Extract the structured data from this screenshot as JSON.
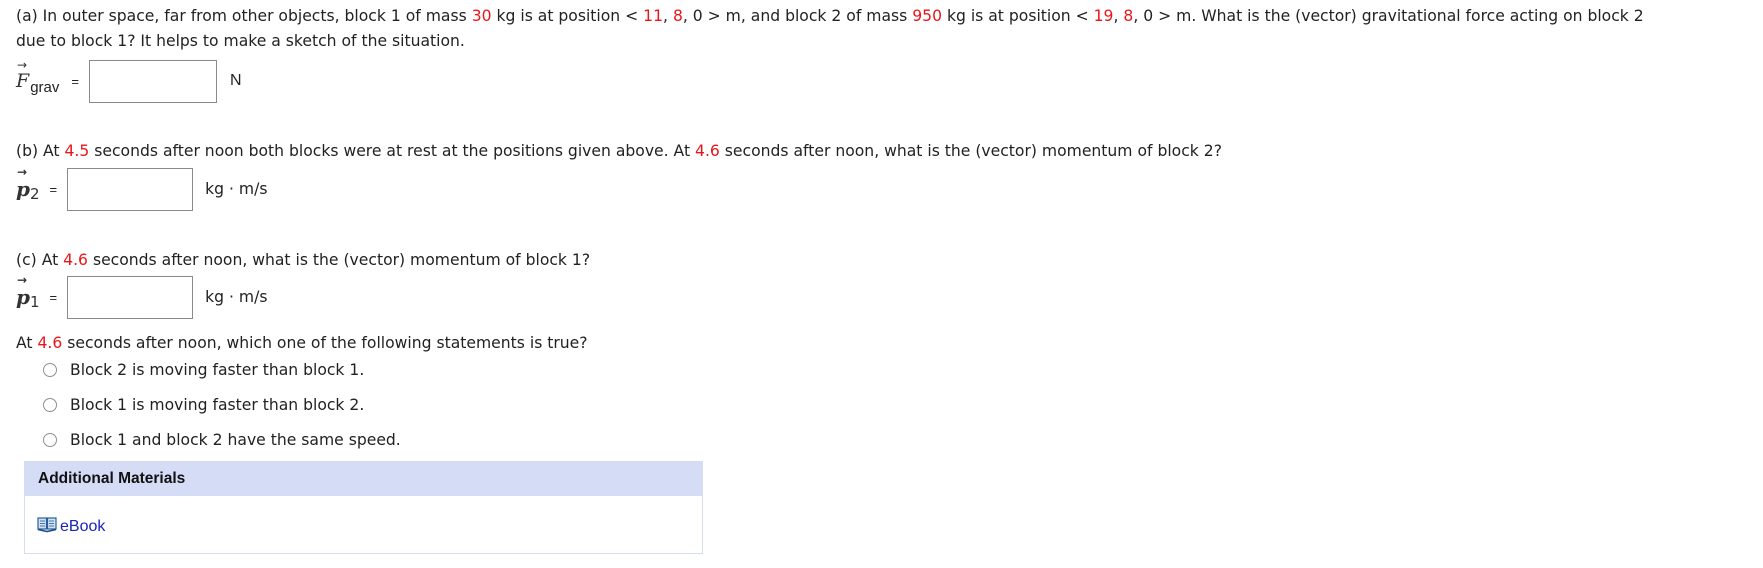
{
  "part_a": {
    "text": [
      {
        "t": "(a) In outer space, far from other objects, block 1 of mass "
      },
      {
        "t": "30",
        "red": true
      },
      {
        "t": " kg is at position < "
      },
      {
        "t": "11",
        "red": true
      },
      {
        "t": ", "
      },
      {
        "t": "8",
        "red": true
      },
      {
        "t": ", 0 > m, and block 2 of mass "
      },
      {
        "t": "950",
        "red": true
      },
      {
        "t": " kg is at position < "
      },
      {
        "t": "19",
        "red": true
      },
      {
        "t": ", "
      },
      {
        "t": "8",
        "red": true
      },
      {
        "t": ", 0 > m. What is the (vector) gravitational force acting on block 2"
      }
    ],
    "line2": "due to block 1? It helps to make a sketch of the situation.",
    "symbol": "F",
    "subscript": "grav",
    "equals": "=",
    "input_value": "",
    "unit": "N"
  },
  "part_b": {
    "prefix": "(b) At ",
    "time1": "4.5",
    "middle": " seconds after noon both blocks were at rest at the positions given above. At ",
    "time2": "4.6",
    "suffix": " seconds after noon, what is the (vector) momentum of block 2?",
    "symbol": "p",
    "subscript": "2",
    "equals": "=",
    "input_value": "",
    "unit": "kg · m/s"
  },
  "part_c": {
    "prefix": "(c) At ",
    "time": "4.6",
    "suffix": " seconds after noon, what is the (vector) momentum of block 1?",
    "symbol": "p",
    "subscript": "1",
    "equals": "=",
    "input_value": "",
    "unit": "kg · m/s"
  },
  "statement_question": {
    "prefix": "At ",
    "time": "4.6",
    "suffix": " seconds after noon, which one of the following statements is true?",
    "options": [
      {
        "label": "Block 2 is moving faster than block 1.",
        "selected": false
      },
      {
        "label": "Block 1 is moving faster than block 2.",
        "selected": false
      },
      {
        "label": "Block 1 and block 2 have the same speed.",
        "selected": false
      }
    ]
  },
  "additional_materials": {
    "title": "Additional Materials",
    "links": [
      {
        "label": "eBook",
        "icon": "book-icon"
      }
    ]
  },
  "colors": {
    "highlight": "#e8161a",
    "panel_header": "#d5dcf6",
    "link": "#1a24b8"
  }
}
